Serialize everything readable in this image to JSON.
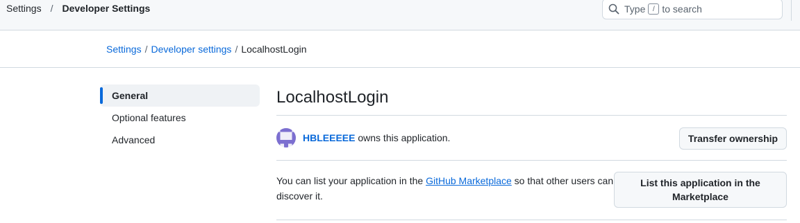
{
  "header": {
    "crumb_root": "Settings",
    "separator": "/",
    "crumb_current": "Developer Settings",
    "search": {
      "prefix": "Type",
      "key": "/",
      "suffix": "to search"
    }
  },
  "breadcrumb": {
    "items": [
      "Settings",
      "Developer settings",
      "LocalhostLogin"
    ],
    "separator": "/"
  },
  "sidebar": {
    "items": [
      {
        "label": "General",
        "active": true
      },
      {
        "label": "Optional features",
        "active": false
      },
      {
        "label": "Advanced",
        "active": false
      }
    ]
  },
  "main": {
    "title": "LocalhostLogin",
    "owner": {
      "name": "HBLEEEEE",
      "text": " owns this application.",
      "button": "Transfer ownership"
    },
    "marketplace": {
      "text_before": "You can list your application in the ",
      "link": "GitHub Marketplace",
      "text_after": " so that other users can discover it.",
      "button": "List this application in the Marketplace"
    }
  },
  "colors": {
    "accent": "#0969da",
    "header_bg": "#f6f8fa",
    "border": "#d1d9e0",
    "avatar_fg": "#7c6fd0"
  },
  "icons": [
    "search-icon",
    "avatar-identicon"
  ]
}
